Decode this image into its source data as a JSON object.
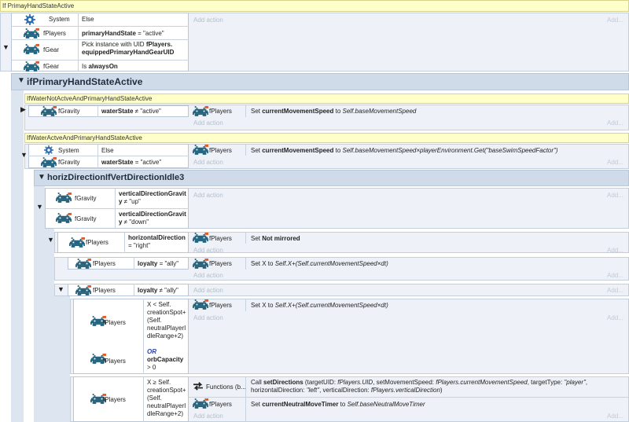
{
  "colors": {
    "comment_bg": "#ffffc9",
    "group_bar": "#d0dbea",
    "event_bg": "#eef2f8",
    "or_blue": "#2a3fb0"
  },
  "comments": {
    "c1": "If PrimayHandStateActive",
    "c2": "IfWaterNotActveAndPrimaryHandStateActive",
    "c3": "IfWaterActveAndPrimaryHandStateActive"
  },
  "groups": {
    "g1": "ifPrimaryHandStateActive",
    "g2": "horizDirectionIfVertDirectionIdle3"
  },
  "common": {
    "add_action": "Add action",
    "dots": "Add...",
    "system": "System",
    "fPlayers": "fPlayers",
    "fGear": "fGear",
    "fGravity": "fGravity",
    "functions": "Functions (b..."
  },
  "e1": {
    "c1": "Else",
    "c2_b": "primaryHandState",
    "c2_r": " = \"active\"",
    "c3_a": "Pick instance with UID ",
    "c3_b": "fPlayers.",
    "c3_c": "equippedPrimaryHandGearUID",
    "c4_a": "Is ",
    "c4_b": "alwaysOn"
  },
  "e2": {
    "cond_b": "waterState",
    "cond_r": " ≠ \"active\"",
    "act_a": "Set ",
    "act_b": "currentMovementSpeed",
    "act_c": " to ",
    "act_i": "Self.baseMovementSpeed"
  },
  "e3": {
    "c1": "Else",
    "c2_b": "waterState",
    "c2_r": " = \"active\"",
    "act_a": "Set ",
    "act_b": "currentMovementSpeed",
    "act_c": " to ",
    "act_i": "Self.baseMovementSpeed×playerEnvironment.Get(\"baseSwimSpeedFactor\")"
  },
  "e4": {
    "c1_b1": "verticalDirectionGravit",
    "c1_b2": "y",
    "c1_r": " ≠ \"up\"",
    "c2_b1": "verticalDirectionGravit",
    "c2_b2": "y",
    "c2_r": " ≠ \"down\""
  },
  "e5": {
    "c_b": "horizontalDirection",
    "c_r": " = \"right\"",
    "act_a": "Set ",
    "act_b": "Not mirrored"
  },
  "e6": {
    "c_b": "loyalty",
    "c_r": " = \"ally\"",
    "act_a": "Set X to ",
    "act_i": "Self.X+(Self.currentMovementSpeed×dt)"
  },
  "e7": {
    "c_b": "loyalty",
    "c_r": " ≠ \"ally\""
  },
  "e8": {
    "c1": "X < Self. creationSpot+ (Self. neutralPlayerI dleRange+2)",
    "or": "OR",
    "c2_b": "orbCapacity",
    "c2_r": "> 0",
    "act_a": "Set X to ",
    "act_i": "Self.X+(Self.currentMovementSpeed×dt)"
  },
  "e9": {
    "c1": "X ≥ Self. creationSpot+ (Self. neutralPlayerI dleRange+2)",
    "act1_a": "Call ",
    "act1_b": "setDirections",
    "act1_c": " (targetUID: ",
    "act1_i1": "fPlayers.UID",
    "act1_d": ", setMovementSpeed: ",
    "act1_i2": "fPlayers.currentMovementSpeed",
    "act1_e": ", targetType: ",
    "act1_i3": "\"player\"",
    "act1_f": ",",
    "act1_g": "horizontalDirection: ",
    "act1_i4": "\"left\"",
    "act1_h": ", verticalDirection: ",
    "act1_i5": "fPlayers.verticalDirection",
    "act1_j": ")",
    "act2_a": "Set ",
    "act2_b": "currentNeutralMoveTimer",
    "act2_c": " to ",
    "act2_i": "Self.baseNeutralMoveTimer"
  }
}
